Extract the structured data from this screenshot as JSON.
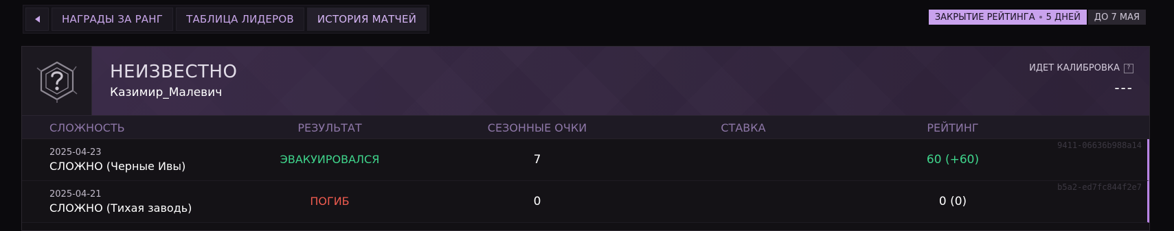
{
  "nav": {
    "back_icon": "triangle-left-icon",
    "tabs": [
      {
        "label": "НАГРАДЫ ЗА РАНГ"
      },
      {
        "label": "ТАБЛИЦА ЛИДЕРОВ"
      },
      {
        "label": "ИСТОРИЯ МАТЧЕЙ",
        "active": true
      }
    ]
  },
  "season": {
    "closing_label": "ЗАКРЫТИЕ РЕЙТИНГА",
    "days_left": "5 ДНЕЙ",
    "until": "ДО 7 МАЯ"
  },
  "profile": {
    "emblem_icon": "unknown-rank-emblem-icon",
    "rank": "НЕИЗВЕСТНО",
    "player_name": "Казимир_Малевич",
    "calibration_label": "ИДЕТ КАЛИБРОВКА",
    "help_label": "?",
    "rating_value": "---"
  },
  "table": {
    "columns": [
      "СЛОЖНОСТЬ",
      "РЕЗУЛЬТАТ",
      "СЕЗОННЫЕ ОЧКИ",
      "СТАВКА",
      "РЕЙТИНГ"
    ],
    "rows": [
      {
        "date": "2025-04-23",
        "difficulty": "СЛОЖНО (Черные Ивы)",
        "result": "ЭВАКУИРОВАЛСЯ",
        "result_color": "#3fd58c",
        "points": "7",
        "stake": "",
        "rating": "60 (+60)",
        "rating_color": "#3fd58c",
        "match_id": "9411-06636b988a14"
      },
      {
        "date": "2025-04-21",
        "difficulty": "СЛОЖНО (Тихая заводь)",
        "result": "ПОГИБ",
        "result_color": "#ee5b4f",
        "points": "0",
        "stake": "",
        "rating": "0 (0)",
        "rating_color": "#ffffff",
        "match_id": "b5a2-ed7fc844f2e7"
      }
    ]
  },
  "colors": {
    "accent": "#c9a2ed",
    "success": "#3fd58c",
    "danger": "#ee5b4f"
  }
}
